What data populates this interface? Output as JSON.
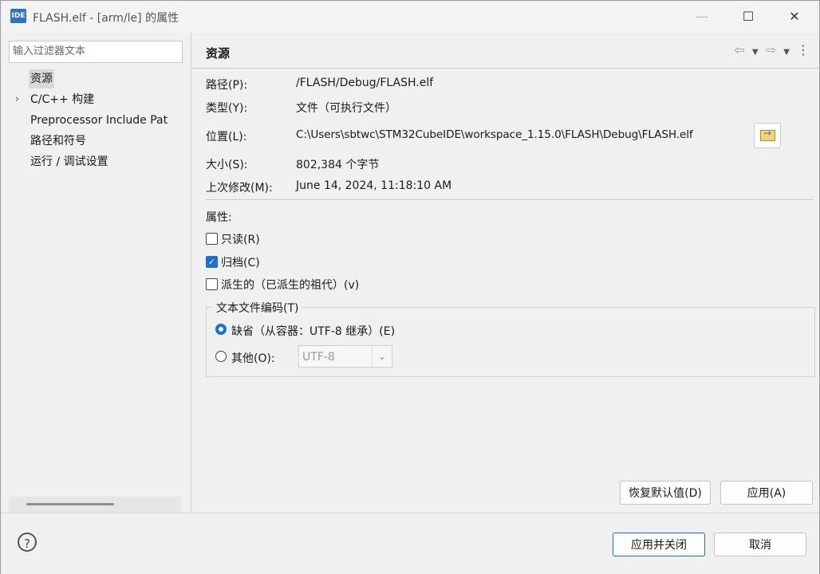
{
  "window": {
    "icon_text": "IDE",
    "title": "FLASH.elf - [arm/le] 的属性",
    "minimize_glyph": "—",
    "maximize_glyph": "☐",
    "close_glyph": "✕"
  },
  "sidebar": {
    "filter_placeholder": "输入过滤器文本",
    "items": [
      {
        "label": "资源",
        "selected": true,
        "expandable": false
      },
      {
        "label": "C/C++ 构建",
        "selected": false,
        "expandable": true
      },
      {
        "label": "Preprocessor Include Pat",
        "selected": false,
        "expandable": false
      },
      {
        "label": "路径和符号",
        "selected": false,
        "expandable": false
      },
      {
        "label": "运行 / 调试设置",
        "selected": false,
        "expandable": false
      }
    ],
    "expand_glyph": "›"
  },
  "page": {
    "title": "资源",
    "nav": {
      "back_glyph": "⇦",
      "forward_glyph": "⇨",
      "dropdown_glyph": "▼",
      "menu_glyph": "⋮"
    },
    "fields": {
      "path": {
        "label": "路径(P):",
        "value": "/FLASH/Debug/FLASH.elf"
      },
      "type": {
        "label": "类型(Y):",
        "value": "文件（可执行文件）"
      },
      "location": {
        "label": "位置(L):",
        "value": "C:\\Users\\sbtwc\\STM32CubeIDE\\workspace_1.15.0\\FLASH\\Debug\\FLASH.elf"
      },
      "size": {
        "label": "大小(S):",
        "value": "802,384 个字节"
      },
      "modified": {
        "label": "上次修改(M):",
        "value": "June 14, 2024, 11:18:10 AM"
      }
    },
    "attributes_label": "属性:",
    "checkboxes": [
      {
        "label": "只读(R)",
        "checked": false
      },
      {
        "label": "归档(C)",
        "checked": true
      },
      {
        "label": "派生的（已派生的祖代）(v)",
        "checked": false
      }
    ],
    "check_glyph": "✓",
    "encoding": {
      "group_title": "文本文件编码(T)",
      "default_label": "缺省（从容器：UTF-8 继承）(E)",
      "default_selected": true,
      "other_label": "其他(O):",
      "other_selected": false,
      "other_value": "UTF-8",
      "dropdown_glyph": "⌄"
    },
    "restore_defaults_label": "恢复默认值(D)",
    "apply_label": "应用(A)"
  },
  "footer": {
    "help_glyph": "?",
    "apply_close_label": "应用并关闭",
    "cancel_label": "取消"
  },
  "colors": {
    "accent": "#1f6fd0",
    "window_bg": "#f0f0f0",
    "selection_bg": "#d9d9d9"
  }
}
